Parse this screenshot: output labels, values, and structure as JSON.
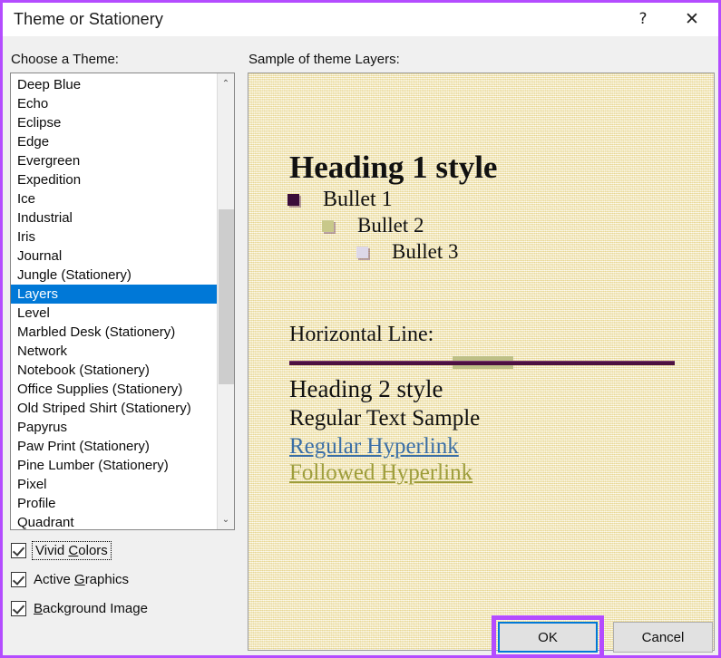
{
  "window": {
    "title": "Theme or Stationery",
    "accent_purple": "#b44cff",
    "focus_blue": "#0078d7"
  },
  "titlebar": {
    "help_glyph": "?",
    "close_glyph": "✕"
  },
  "labels": {
    "choose_theme": "Choose a Theme:",
    "sample_of_theme": "Sample of theme Layers:"
  },
  "theme_list": {
    "selected": "Layers",
    "items": [
      "Deep Blue",
      "Echo",
      "Eclipse",
      "Edge",
      "Evergreen",
      "Expedition",
      "Ice",
      "Industrial",
      "Iris",
      "Journal",
      "Jungle (Stationery)",
      "Layers",
      "Level",
      "Marbled Desk (Stationery)",
      "Network",
      "Notebook (Stationery)",
      "Office Supplies (Stationery)",
      "Old Striped Shirt (Stationery)",
      "Papyrus",
      "Paw Print (Stationery)",
      "Pine Lumber (Stationery)",
      "Pixel",
      "Profile",
      "Quadrant"
    ],
    "scroll_up_glyph": "⌃",
    "scroll_down_glyph": "⌄"
  },
  "checkboxes": [
    {
      "label_before": "Vivid ",
      "accel": "C",
      "label_after": "olors",
      "checked": true,
      "focused": true
    },
    {
      "label_before": "Active ",
      "accel": "G",
      "label_after": "raphics",
      "checked": true,
      "focused": false
    },
    {
      "label_before": "",
      "accel": "B",
      "label_after": "ackground Image",
      "checked": true,
      "focused": false
    }
  ],
  "preview": {
    "heading1": "Heading 1 style",
    "bullet1": "Bullet 1",
    "bullet2": "Bullet 2",
    "bullet3": "Bullet 3",
    "horizontal_line_label": "Horizontal Line:",
    "heading2": "Heading 2 style",
    "regular_text": "Regular Text Sample",
    "hyperlink": "Regular Hyperlink",
    "followed_hyperlink": "Followed Hyperlink",
    "colors": {
      "background": "#f2e8c4",
      "bullet1": "#3a0d3a",
      "bullet2": "#c8c88a",
      "bullet3": "#ddd8e8",
      "rule": "#4c1040",
      "rule_block": "#bec086",
      "hyperlink": "#3a6ea5",
      "followed_hyperlink": "#9d9d3c"
    }
  },
  "buttons": {
    "ok": "OK",
    "cancel": "Cancel"
  }
}
